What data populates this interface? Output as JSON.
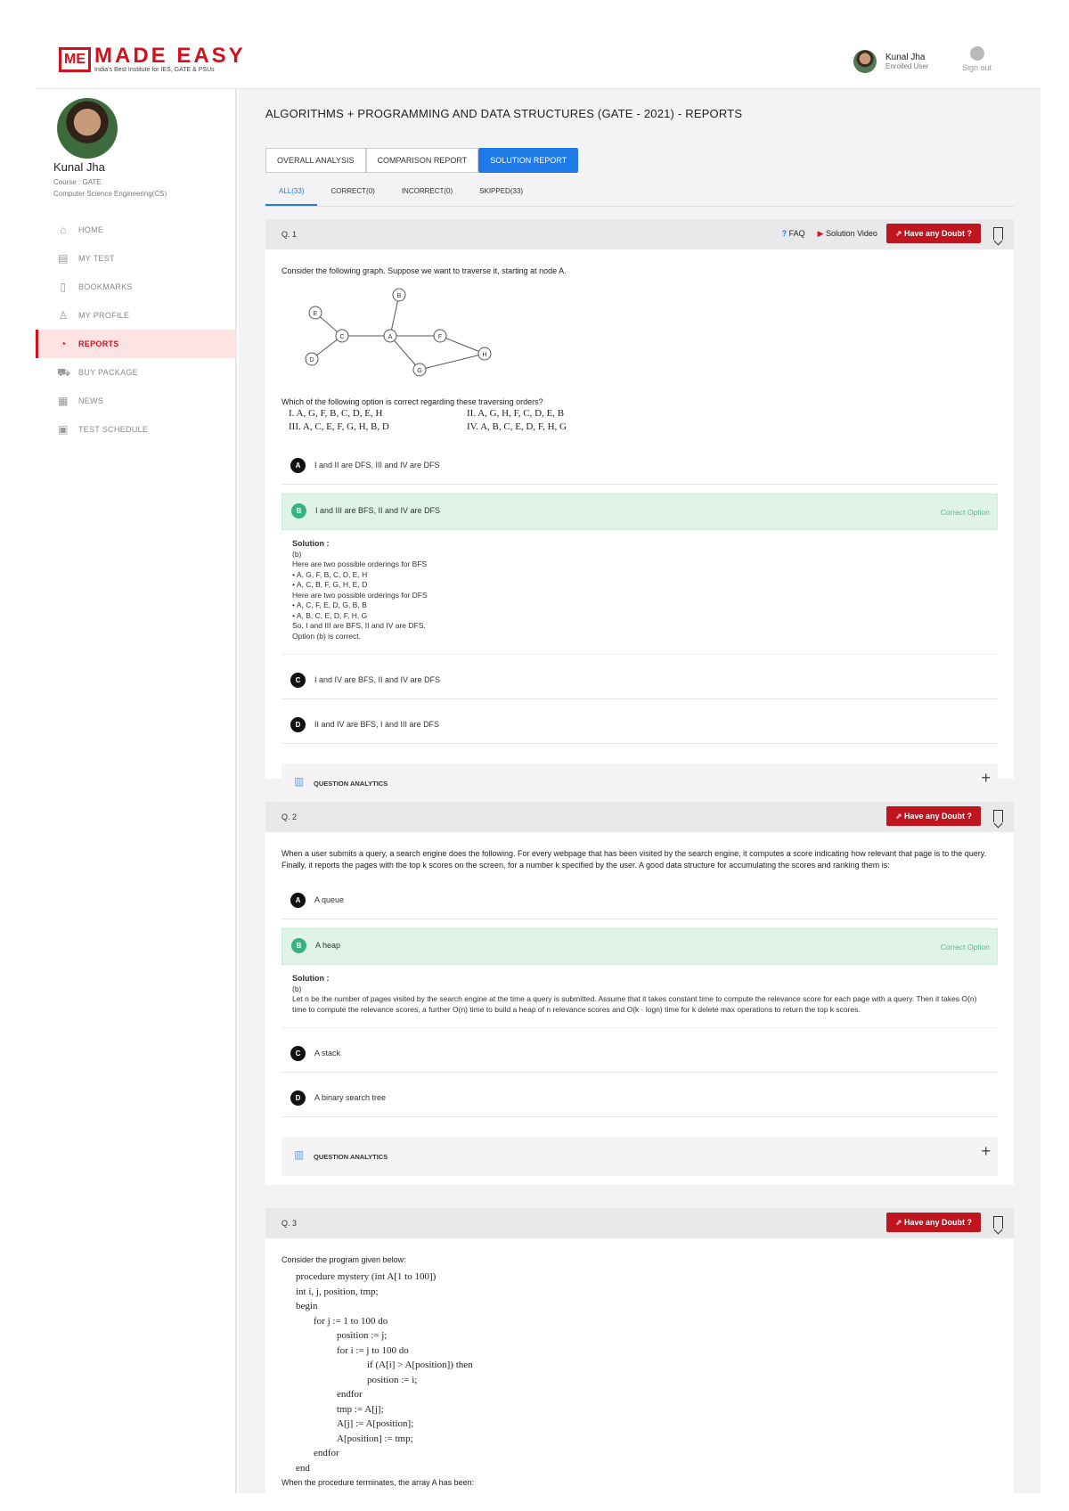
{
  "header": {
    "logo_mark": "ME",
    "logo_name": "MADE EASY",
    "logo_tagline": "India's Best Institute for IES, GATE & PSUs",
    "user_name": "Kunal Jha",
    "user_role": "Enrolled User",
    "signout_label": "Sign out"
  },
  "sidebar": {
    "name": "Kunal Jha",
    "course": "Course : GATE",
    "branch": "Computer Science Engineering(CS)",
    "items": [
      {
        "label": "HOME",
        "icon": "home-icon"
      },
      {
        "label": "MY TEST",
        "icon": "test-icon"
      },
      {
        "label": "BOOKMARKS",
        "icon": "bookmark-icon"
      },
      {
        "label": "MY PROFILE",
        "icon": "profile-icon"
      },
      {
        "label": "REPORTS",
        "icon": "reports-icon",
        "active": true
      },
      {
        "label": "BUY PACKAGE",
        "icon": "cart-icon"
      },
      {
        "label": "NEWS",
        "icon": "news-icon"
      },
      {
        "label": "TEST SCHEDULE",
        "icon": "calendar-icon"
      }
    ]
  },
  "main": {
    "title": "ALGORITHMS + PROGRAMMING AND DATA STRUCTURES (GATE - 2021) - REPORTS",
    "tabs": [
      "OVERALL ANALYSIS",
      "COMPARISON REPORT",
      "SOLUTION REPORT"
    ],
    "subtabs": [
      "ALL(33)",
      "CORRECT(0)",
      "INCORRECT(0)",
      "SKIPPED(33)"
    ],
    "faq_label": "FAQ",
    "solution_video_label": "Solution Video",
    "doubt_label": "Have any Doubt ?",
    "correct_option_label": "Correct Option",
    "analytics_label": "QUESTION ANALYTICS",
    "solution_label": "Solution :"
  },
  "q1": {
    "number": "Q. 1",
    "text": "Consider the following graph. Suppose we want to traverse it, starting at node A.",
    "graph_nodes": [
      "B",
      "E",
      "C",
      "A",
      "F",
      "H",
      "D",
      "G"
    ],
    "question": "Which of the following option is correct regarding these traversing orders?",
    "orders": [
      "I.   A, G, F, B, C, D, E, H",
      "II.  A, G, H, F, C, D, E, B",
      "III. A, C, E, F, G, H, B, D",
      "IV. A, B, C, E, D, F, H, G"
    ],
    "options": [
      {
        "letter": "A",
        "text": "I and II are DFS, III and IV are DFS"
      },
      {
        "letter": "B",
        "text": "I and III are BFS, II and IV are DFS",
        "correct": true
      },
      {
        "letter": "C",
        "text": "I and IV are BFS, II and IV are DFS"
      },
      {
        "letter": "D",
        "text": "II and IV are BFS, I and III are DFS"
      }
    ],
    "solution_lines": [
      "(b)",
      "Here are two possible orderings for BFS",
      "• A, G, F, B, C, D, E, H",
      "• A, C, B, F, G, H, E, D",
      "Here are two possible orderings for DFS",
      "• A, C, F, E, D, G, B, B",
      "• A, B, C, E, D, F, H, G",
      "So, I and III are BFS, II and IV are DFS.",
      "Option (b) is correct."
    ]
  },
  "q2": {
    "number": "Q. 2",
    "text": "When a user submits a query, a search engine does the following. For every webpage that has been visited by the search engine, it computes a score indicating how relevant that page is to the query. Finally, it reports the pages with the top k scores on the screen, for a number k specified by the user. A good data structure for accumulating the scores and ranking them is:",
    "options": [
      {
        "letter": "A",
        "text": "A queue"
      },
      {
        "letter": "B",
        "text": "A heap",
        "correct": true
      },
      {
        "letter": "C",
        "text": "A stack"
      },
      {
        "letter": "D",
        "text": "A binary search tree"
      }
    ],
    "solution_lines": [
      "(b)",
      "Let n be the number of pages visited by the search engine at the time a query is submitted. Assume that it takes constant time to compute the relevance score for each page with a query. Then it takes O(n) time to compute the relevance scores, a further O(n) time to build a heap of n relevance scores and O(k · logn) time for k delete max operations to return the top k scores."
    ]
  },
  "q3": {
    "number": "Q. 3",
    "intro": "Consider the program given below:",
    "code_lines": [
      "procedure mystery (int A[1 to 100])",
      "int i, j, position, tmp;",
      "begin",
      "for j := 1 to 100 do",
      "position := j;",
      "for i := j to 100 do",
      "if (A[i] > A[position]) then",
      "position := i;",
      "endfor",
      "tmp := A[j];",
      "A[j] := A[position];",
      "A[position] := tmp;",
      "endfor",
      "end",
      "When the procedure terminates, the array A has been:"
    ]
  },
  "colors": {
    "brand_red": "#d0121c",
    "accent_blue": "#1f7ae8",
    "correct_green": "#36b37e"
  }
}
